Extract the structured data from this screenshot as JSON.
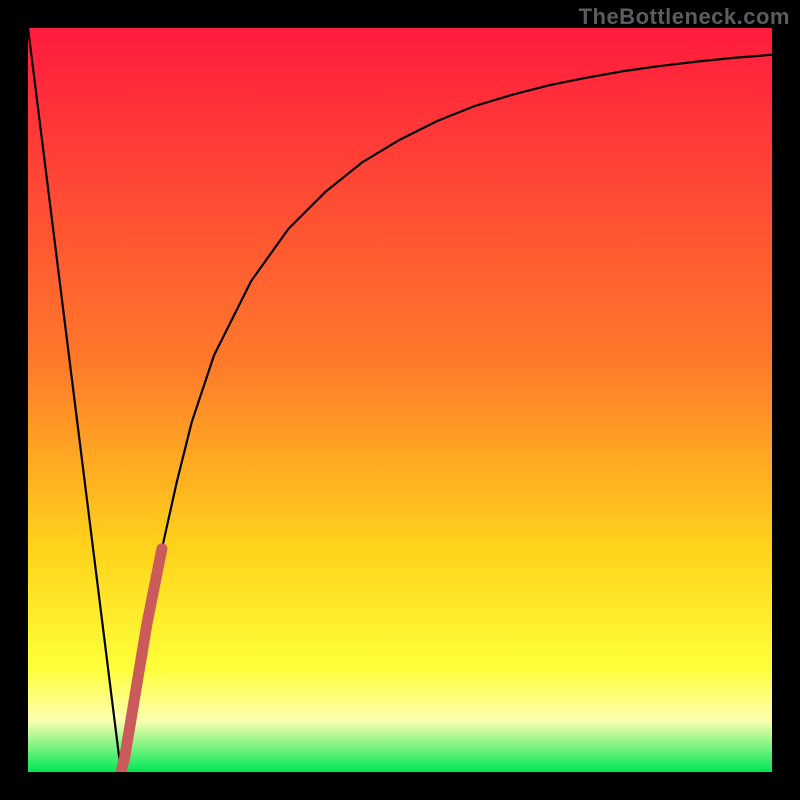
{
  "watermark": "TheBottleneck.com",
  "colors": {
    "frame": "#000000",
    "curve_main": "#000000",
    "curve_accent": "#cb5a5b",
    "gradient_top": "#ff1b3e",
    "gradient_upper_mid": "#ff7a2a",
    "gradient_mid": "#ffd31b",
    "gradient_lower_mid": "#ffff3a",
    "gradient_pale": "#ffffb0",
    "gradient_bottom": "#00e756"
  },
  "chart_data": {
    "type": "line",
    "title": "",
    "xlabel": "",
    "ylabel": "",
    "xlim": [
      0,
      100
    ],
    "ylim": [
      0,
      100
    ],
    "series": [
      {
        "name": "bottleneck-curve",
        "x": [
          0,
          2,
          4,
          6,
          8,
          10,
          12,
          12.5,
          13,
          14,
          15,
          16,
          18,
          20,
          22,
          25,
          30,
          35,
          40,
          45,
          50,
          55,
          60,
          65,
          70,
          75,
          80,
          85,
          90,
          95,
          100
        ],
        "values": [
          100,
          84,
          68,
          52,
          36,
          20,
          4,
          0,
          2,
          8,
          14,
          20,
          30,
          39,
          47,
          56,
          66,
          73,
          78,
          82,
          85,
          87.5,
          89.5,
          91,
          92.3,
          93.3,
          94.2,
          94.9,
          95.5,
          96,
          96.4
        ]
      },
      {
        "name": "accent-segment",
        "x": [
          12.5,
          13,
          14,
          15,
          16,
          17,
          18
        ],
        "values": [
          0,
          2,
          8,
          14,
          20,
          25,
          30
        ]
      }
    ],
    "gradient_bands_pct_from_top": [
      {
        "offset": 0,
        "role": "top"
      },
      {
        "offset": 45,
        "role": "upper_mid"
      },
      {
        "offset": 70,
        "role": "mid"
      },
      {
        "offset": 86,
        "role": "lower_mid"
      },
      {
        "offset": 93,
        "role": "pale"
      },
      {
        "offset": 100,
        "role": "bottom"
      }
    ]
  }
}
